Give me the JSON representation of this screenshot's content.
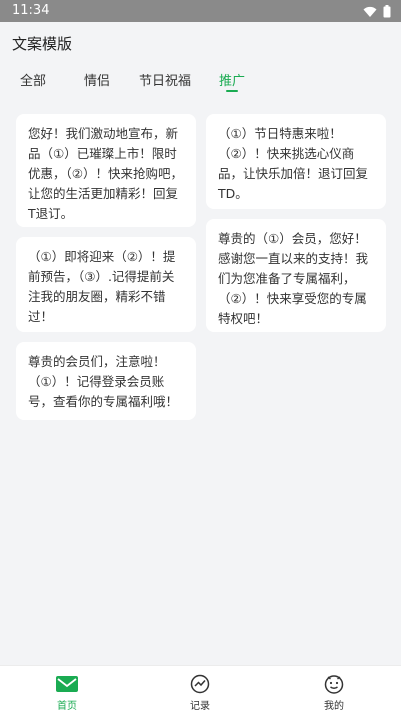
{
  "status_bar": {
    "time": "11:34"
  },
  "page_title": "文案模版",
  "tabs": [
    {
      "label": "全部"
    },
    {
      "label": "情侣"
    },
    {
      "label": "节日祝福"
    },
    {
      "label": "推广"
    }
  ],
  "active_tab_index": 3,
  "cards": {
    "left": [
      {
        "text": "您好！我们激动地宣布，新品（①）已璀璨上市！限时优惠，（②）！快来抢购吧，让您的生活更加精彩！回复T退订。"
      },
      {
        "text": "（①）即将迎来（②）！提前预告，（③）.记得提前关注我的朋友圈，精彩不错过！"
      },
      {
        "text": "尊贵的会员们，注意啦！（①）！记得登录会员账号，查看你的专属福利哦！"
      }
    ],
    "right": [
      {
        "text": "（①）节日特惠来啦！（②）！快来挑选心仪商品，让快乐加倍！退订回复TD。"
      },
      {
        "text": "尊贵的（①）会员，您好！感谢您一直以来的支持！我们为您准备了专属福利，（②）！快来享受您的专属特权吧！"
      }
    ]
  },
  "bottom_nav": [
    {
      "label": "首页",
      "icon": "mail-icon"
    },
    {
      "label": "记录",
      "icon": "trend-icon"
    },
    {
      "label": "我的",
      "icon": "face-icon"
    }
  ],
  "colors": {
    "accent": "#1aab52",
    "background": "#f3f4f6",
    "status_bar": "#8a8a8a"
  }
}
